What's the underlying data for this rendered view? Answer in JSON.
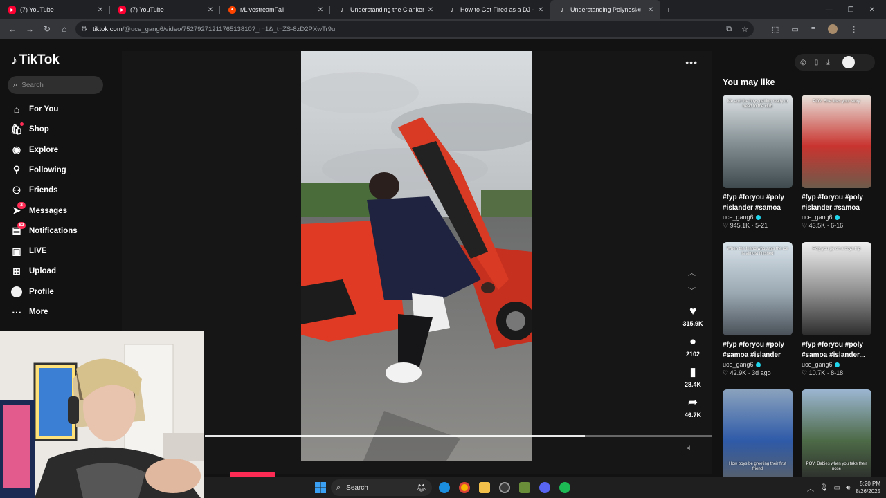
{
  "browser": {
    "tabs": [
      {
        "label": "(7) YouTube",
        "favicon": "youtube-icon",
        "active": false,
        "audio": false
      },
      {
        "label": "(7) YouTube",
        "favicon": "youtube-icon",
        "active": false,
        "audio": false
      },
      {
        "label": "r/LivestreamFail",
        "favicon": "reddit-icon",
        "active": false,
        "audio": false
      },
      {
        "label": "Understanding the Clanker Me",
        "favicon": "tiktok-icon",
        "active": false,
        "audio": false
      },
      {
        "label": "How to Get Fired as a DJ - Tips",
        "favicon": "tiktok-icon",
        "active": false,
        "audio": false
      },
      {
        "label": "Understanding Polynesian (",
        "favicon": "tiktok-icon",
        "active": true,
        "audio": true
      }
    ],
    "url_domain": "tiktok.com",
    "url_path": "/@uce_gang6/video/7527927121176513810?_r=1&_t=ZS-8zD2PXwTr9u"
  },
  "tiktok": {
    "logo_text": "TikTok",
    "search_placeholder": "Search",
    "nav": [
      {
        "label": "For You",
        "icon": "home-icon"
      },
      {
        "label": "Shop",
        "icon": "shop-bag-icon"
      },
      {
        "label": "Explore",
        "icon": "compass-icon"
      },
      {
        "label": "Following",
        "icon": "user-follow-icon"
      },
      {
        "label": "Friends",
        "icon": "friends-icon"
      },
      {
        "label": "Messages",
        "icon": "send-icon",
        "badge": "2"
      },
      {
        "label": "Notifications",
        "icon": "inbox-icon",
        "badge": "82"
      },
      {
        "label": "LIVE",
        "icon": "live-icon"
      },
      {
        "label": "Upload",
        "icon": "upload-icon"
      },
      {
        "label": "Profile",
        "icon": "profile-avatar"
      },
      {
        "label": "More",
        "icon": "more-dots-icon"
      }
    ],
    "actions": {
      "likes": "315.9K",
      "comments": "2102",
      "saves": "28.4K",
      "shares": "46.7K"
    },
    "progress_fraction": 0.75,
    "recs_title": "You may like",
    "recs": [
      {
        "title": "#fyp #foryou #poly #islander #samoa",
        "author": "uce_gang6",
        "stats": "945.1K · 5-21",
        "caption": "Me and the boys getting ready to head to the club",
        "caption2": "",
        "colors": [
          "#dfe3e6",
          "#7f8b8f",
          "#3f4a4e"
        ]
      },
      {
        "title": "#fyp #foryou #poly #islander #samoa",
        "author": "uce_gang6",
        "stats": "43.5K · 6-16",
        "caption": "POV: She likes your story",
        "caption2": "",
        "colors": [
          "#e8e3dc",
          "#c9342f",
          "#6e5b4b"
        ]
      },
      {
        "title": "#fyp #foryou #poly #samoa #islander",
        "author": "uce_gang6",
        "stats": "42.9K · 3d ago",
        "caption": "When the friend who says the ice is almost finished",
        "caption2": "",
        "colors": [
          "#d9e3ea",
          "#9aa8b2",
          "#4a5158"
        ]
      },
      {
        "title": "#fyp #foryou #poly #samoa #islander...",
        "author": "uce_gang6",
        "stats": "10.7K · 8-18",
        "caption": "Poly you go on a boys trip",
        "caption2": "",
        "colors": [
          "#efefef",
          "#8c8c8c",
          "#2d2d2d"
        ]
      },
      {
        "title": "",
        "author": "",
        "stats": "",
        "caption": "",
        "caption2": "How boys be greeting their first friend",
        "colors": [
          "#8aa2bd",
          "#2e5aa8",
          "#5b6167"
        ]
      },
      {
        "title": "",
        "author": "",
        "stats": "",
        "caption": "",
        "caption2": "POV: Babies when you take their nose",
        "colors": [
          "#9cb6d2",
          "#4d6a47",
          "#2a2a2a"
        ]
      }
    ]
  },
  "taskbar": {
    "search_label": "Search",
    "time": "5:20 PM",
    "date": "8/26/2025"
  },
  "colors": {
    "tiktok_red": "#fe2c55",
    "tiktok_cyan": "#20d5ec",
    "tab_bar": "#202124",
    "page_bg": "#121212"
  }
}
